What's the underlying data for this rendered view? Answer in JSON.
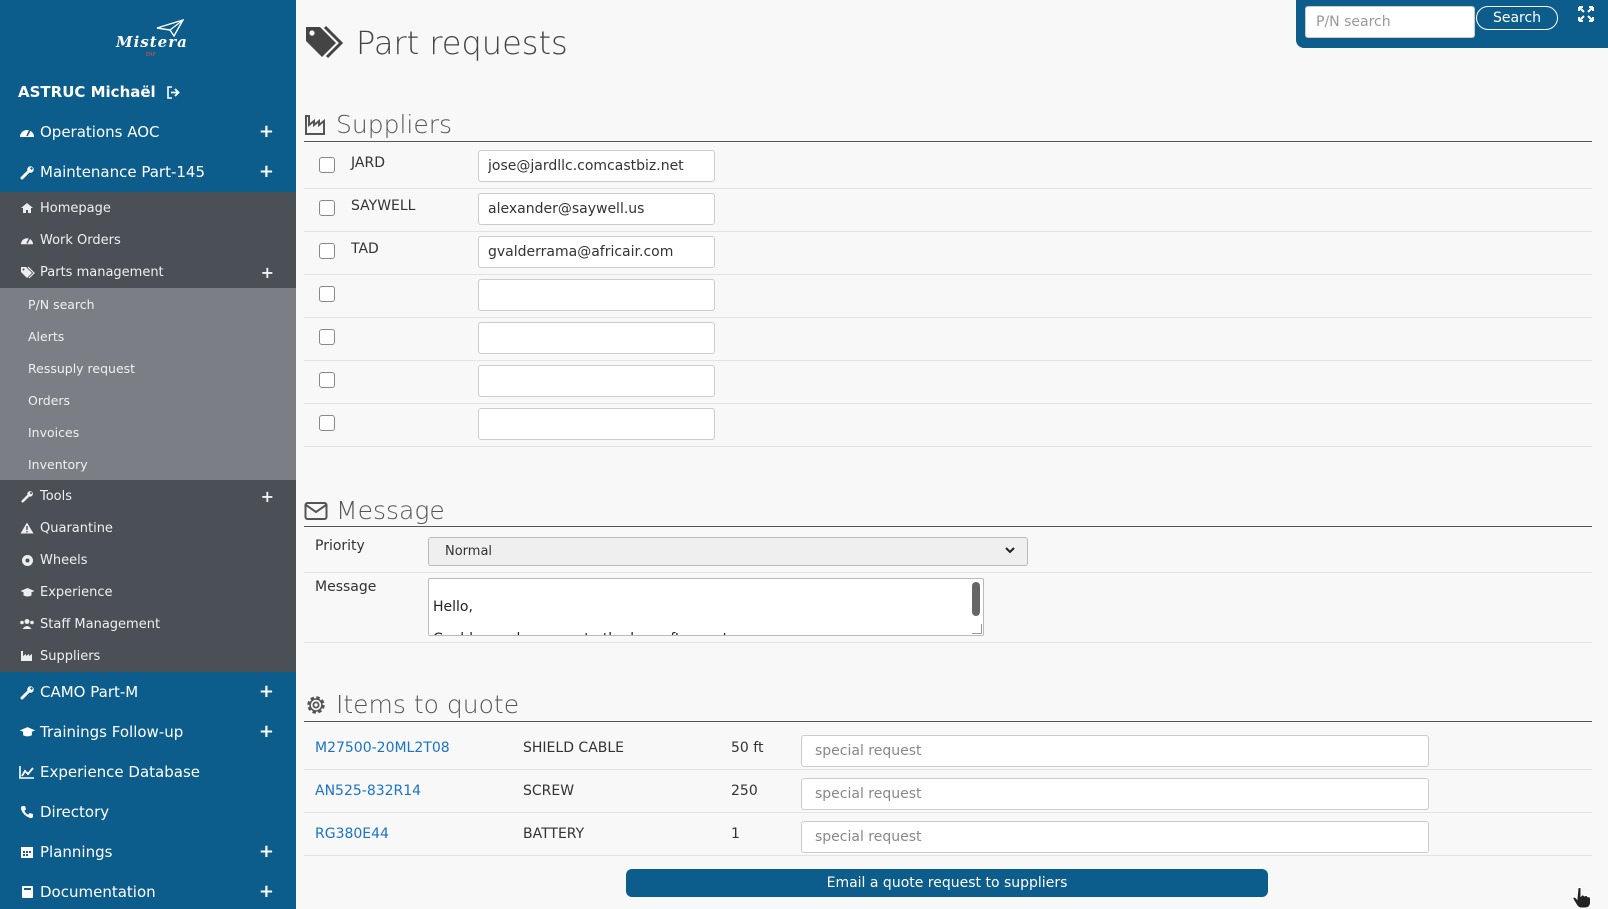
{
  "brand": {
    "logo_text": "Mistera",
    "logo_sub": "ERP"
  },
  "user": {
    "name": "ASTRUC Michaël"
  },
  "sidebar": {
    "top": [
      {
        "label": "Operations AOC",
        "icon": "dashboard-icon"
      },
      {
        "label": "Maintenance Part-145",
        "icon": "wrench-icon"
      }
    ],
    "maintenance_items": [
      {
        "label": "Homepage",
        "icon": "home-icon"
      },
      {
        "label": "Work Orders",
        "icon": "dashboard-icon"
      },
      {
        "label": "Parts management",
        "icon": "tags-icon"
      }
    ],
    "parts_items": [
      {
        "label": "P/N search"
      },
      {
        "label": "Alerts"
      },
      {
        "label": "Ressuply request"
      },
      {
        "label": "Orders"
      },
      {
        "label": "Invoices"
      },
      {
        "label": "Inventory"
      }
    ],
    "maintenance_more": [
      {
        "label": "Tools",
        "icon": "wrench-icon"
      },
      {
        "label": "Quarantine",
        "icon": "warning-icon"
      },
      {
        "label": "Wheels",
        "icon": "wheel-icon"
      },
      {
        "label": "Experience",
        "icon": "graduation-cap-icon"
      },
      {
        "label": "Staff Management",
        "icon": "users-icon"
      },
      {
        "label": "Suppliers",
        "icon": "industry-icon"
      }
    ],
    "bottom": [
      {
        "label": "CAMO Part-M",
        "icon": "wrench-icon"
      },
      {
        "label": "Trainings Follow-up",
        "icon": "graduation-cap-icon"
      },
      {
        "label": "Experience Database",
        "icon": "chart-icon"
      },
      {
        "label": "Directory",
        "icon": "phone-icon"
      },
      {
        "label": "Plannings",
        "icon": "calendar-icon"
      },
      {
        "label": "Documentation",
        "icon": "book-icon"
      }
    ]
  },
  "topsearch": {
    "placeholder": "P/N search",
    "button": "Search"
  },
  "page": {
    "title": "Part requests"
  },
  "suppliers": {
    "title": "Suppliers",
    "rows": [
      {
        "name": "JARD",
        "email": "jose@jardllc.comcastbiz.net"
      },
      {
        "name": "SAYWELL",
        "email": "alexander@saywell.us"
      },
      {
        "name": "TAD",
        "email": "gvalderrama@africair.com"
      },
      {
        "name": "",
        "email": ""
      },
      {
        "name": "",
        "email": ""
      },
      {
        "name": "",
        "email": ""
      },
      {
        "name": "",
        "email": ""
      }
    ]
  },
  "message": {
    "title": "Message",
    "priority_label": "Priority",
    "priority_value": "Normal",
    "message_label": "Message",
    "message_text": "Hello,\n\nCould you please quote the hereafter parts:"
  },
  "items": {
    "title": "Items to quote",
    "placeholder": "special request",
    "rows": [
      {
        "pn": "M27500-20ML2T08",
        "desc": "SHIELD CABLE",
        "qty": "50 ft"
      },
      {
        "pn": "AN525-832R14",
        "desc": "SCREW",
        "qty": "250"
      },
      {
        "pn": "RG380E44",
        "desc": "BATTERY",
        "qty": "1"
      }
    ]
  },
  "actions": {
    "email_button": "Email a quote request to suppliers"
  }
}
